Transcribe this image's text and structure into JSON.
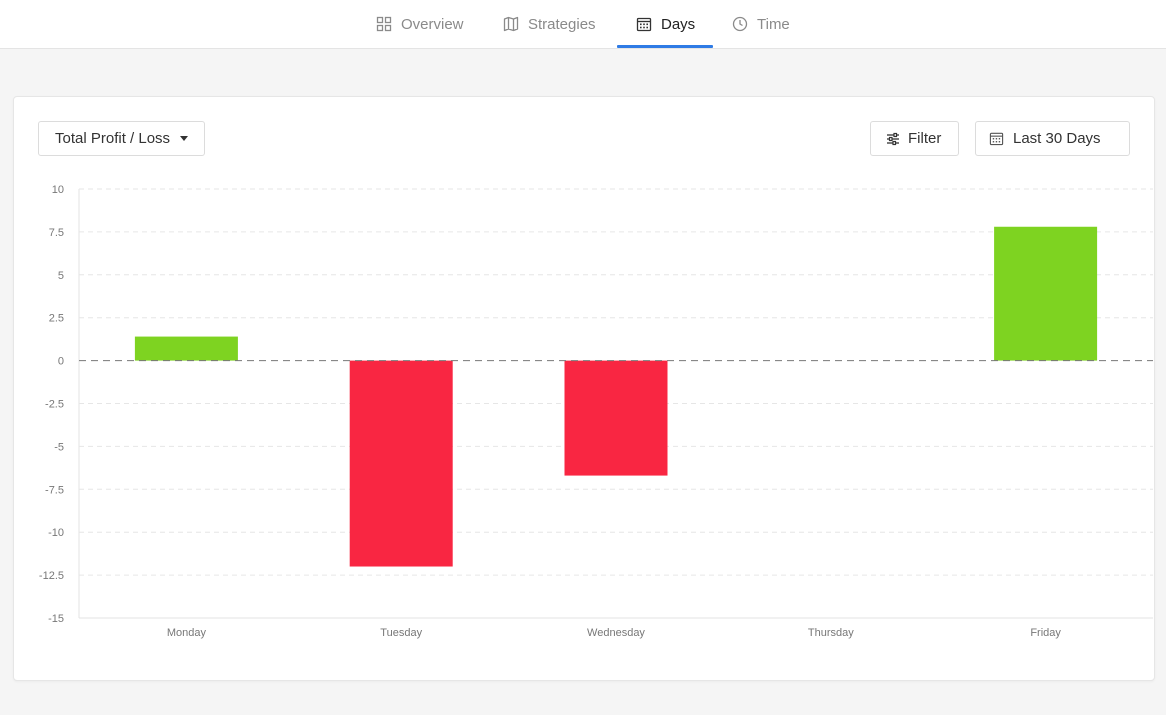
{
  "nav": {
    "tabs": [
      {
        "label": "Overview",
        "icon": "grid-icon",
        "active": false
      },
      {
        "label": "Strategies",
        "icon": "map-icon",
        "active": false
      },
      {
        "label": "Days",
        "icon": "calendar-icon",
        "active": true
      },
      {
        "label": "Time",
        "icon": "clock-icon",
        "active": false
      }
    ]
  },
  "toolbar": {
    "metric_label": "Total Profit / Loss",
    "filter_label": "Filter",
    "range_label": "Last 30 Days"
  },
  "colors": {
    "positive": "#7ed321",
    "negative": "#f92642",
    "accent": "#2f7be5"
  },
  "chart_data": {
    "type": "bar",
    "categories": [
      "Monday",
      "Tuesday",
      "Wednesday",
      "Thursday",
      "Friday"
    ],
    "values": [
      1.4,
      -12.0,
      -6.7,
      0,
      7.8
    ],
    "ylim": [
      -15,
      10
    ],
    "yticks": [
      10,
      7.5,
      5,
      2.5,
      0,
      -2.5,
      -5,
      -7.5,
      -10,
      -12.5,
      -15
    ],
    "ytick_labels": [
      "10",
      "7.5",
      "5",
      "2.5",
      "0",
      "-2.5",
      "-5",
      "-7.5",
      "-10",
      "-12.5",
      "-15"
    ],
    "grid": true,
    "title": "",
    "xlabel": "",
    "ylabel": ""
  }
}
